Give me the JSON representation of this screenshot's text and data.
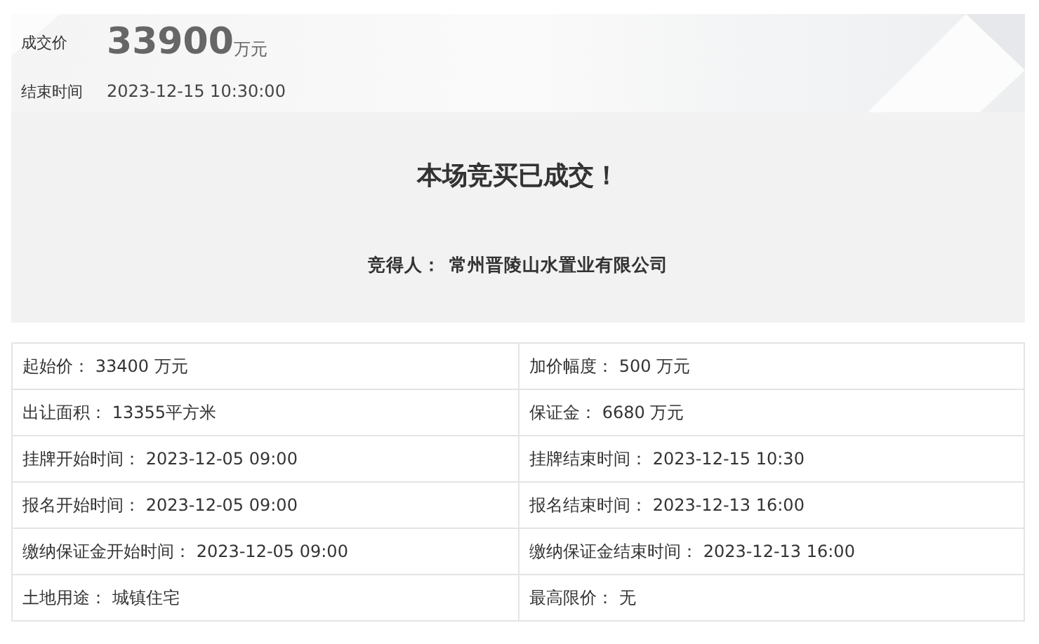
{
  "summary": {
    "price_label": "成交价",
    "price": "33900",
    "price_unit": "万元",
    "end_label": "结束时间",
    "end_time": "2023-12-15 10:30:00"
  },
  "result": {
    "title": "本场竞买已成交！",
    "winner_label": "竞得人：",
    "winner": "常州晋陵山水置业有限公司"
  },
  "details": [
    [
      "起始价： 33400 万元",
      "加价幅度： 500 万元"
    ],
    [
      "出让面积： 13355平方米",
      "保证金： 6680 万元"
    ],
    [
      "挂牌开始时间： 2023-12-05 09:00",
      "挂牌结束时间： 2023-12-15 10:30"
    ],
    [
      "报名开始时间： 2023-12-05 09:00",
      "报名结束时间： 2023-12-13 16:00"
    ],
    [
      "缴纳保证金开始时间： 2023-12-05 09:00",
      "缴纳保证金结束时间： 2023-12-13 16:00"
    ],
    [
      "土地用途： 城镇住宅",
      "最高限价： 无"
    ]
  ]
}
